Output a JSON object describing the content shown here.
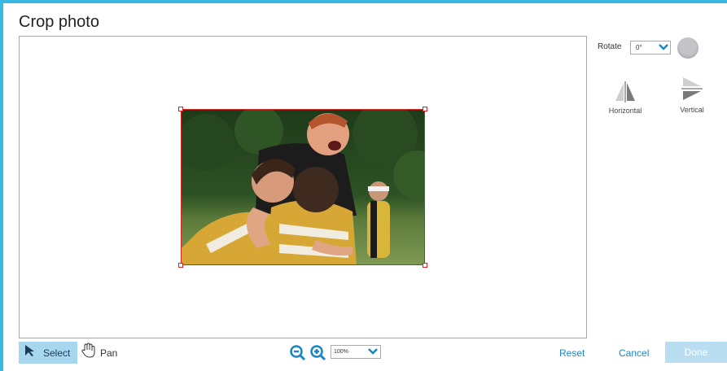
{
  "dialog": {
    "title": "Crop photo"
  },
  "sidebar": {
    "rotate_label": "Rotate",
    "rotate_value": "0°",
    "flip_horizontal_label": "Horizontal",
    "flip_vertical_label": "Vertical"
  },
  "toolbar": {
    "select_label": "Select",
    "pan_label": "Pan",
    "zoom_value": "100%",
    "reset_label": "Reset",
    "cancel_label": "Cancel",
    "done_label": "Done"
  },
  "colors": {
    "accent": "#39b8e4",
    "crop_border": "#d8221f",
    "link": "#1a86c5",
    "select_active_bg": "#a7d7ee",
    "done_disabled_bg": "#b9def2"
  },
  "icons": [
    "select-arrow-icon",
    "pan-hand-icon",
    "zoom-out-icon",
    "zoom-in-icon",
    "chevron-down-icon",
    "flip-horizontal-icon",
    "flip-vertical-icon"
  ]
}
